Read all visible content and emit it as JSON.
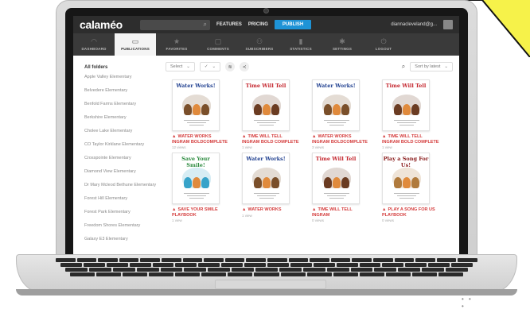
{
  "app": {
    "logo": "calaméo",
    "search_icon": "⌕"
  },
  "topnav": {
    "features": "FEATURES",
    "pricing": "PRICING",
    "publish": "PUBLISH",
    "user": "diannacleveland@g..."
  },
  "tabs": [
    {
      "label": "DASHBOARD",
      "icon": "dashboard-icon",
      "glyph": "◠"
    },
    {
      "label": "PUBLICATIONS",
      "icon": "document-icon",
      "glyph": "▭",
      "active": true
    },
    {
      "label": "FAVORITES",
      "icon": "star-icon",
      "glyph": "★"
    },
    {
      "label": "COMMENTS",
      "icon": "comment-icon",
      "glyph": "▢"
    },
    {
      "label": "SUBSCRIBERS",
      "icon": "users-icon",
      "glyph": "⚇"
    },
    {
      "label": "STATISTICS",
      "icon": "chart-icon",
      "glyph": "▮"
    },
    {
      "label": "SETTINGS",
      "icon": "gear-icon",
      "glyph": "✱"
    },
    {
      "label": "LOGOUT",
      "icon": "power-icon",
      "glyph": "⏻"
    }
  ],
  "sidebar": {
    "heading": "All folders",
    "folders": [
      "Apple Valley Elementary",
      "Belvedere Elementary",
      "Benfold Farms Elementary",
      "Berkshire Elementary",
      "Cholee Lake Elementary",
      "CO Taylor Kirklane Elementary",
      "Crosspointe Elementary",
      "Diamond View Elementary",
      "Dr Mary Mcleod Bethune Elementary",
      "Forest Hill Elementary",
      "Forest Park Elementary",
      "Freedom Shores Elementary",
      "Galaxy E3 Elementary"
    ]
  },
  "toolbar": {
    "select_label": "Select",
    "sort_label": "Sort by latest",
    "caret": "⌄",
    "layers_icon": "≋",
    "share_icon": "≺",
    "search_icon": "⌕"
  },
  "publications": [
    {
      "cover_title": "Water Works!",
      "title": "WATER WORKS INGRAM BOLDCOMPLETE",
      "views": "12 views",
      "title_color": "#1f3f8f",
      "art_color": "#7a4f2a"
    },
    {
      "cover_title": "Time Will Tell",
      "title": "TIME WILL TELL INGRAM BOLD COMPLETE",
      "views": "1 view",
      "title_color": "#c4252d",
      "art_color": "#6b3c22"
    },
    {
      "cover_title": "Water Works!",
      "title": "WATER WORKS INGRAM BOLDCOMPLETE",
      "views": "3 views",
      "title_color": "#1f3f8f",
      "art_color": "#7a4f2a"
    },
    {
      "cover_title": "Time Will Tell",
      "title": "TIME WILL TELL INGRAM BOLD COMPLETE",
      "views": "1 view",
      "title_color": "#c4252d",
      "art_color": "#6b3c22"
    },
    {
      "cover_title": "Save Your Smile!",
      "title": "SAVE YOUR SMILE PLAYBOOK",
      "views": "1 view",
      "title_color": "#2b8a3e",
      "art_color": "#37a3c9"
    },
    {
      "cover_title": "Water Works!",
      "title": "WATER WORKS",
      "views": "1 view",
      "title_color": "#1f3f8f",
      "art_color": "#7a4f2a"
    },
    {
      "cover_title": "Time Will Tell",
      "title": "TIME WILL TELL INGRAM",
      "views": "0 views",
      "title_color": "#c4252d",
      "art_color": "#6b3c22"
    },
    {
      "cover_title": "Play a Song For Us!",
      "title": "PLAY A SONG FOR US PLAYBOOK",
      "views": "0 views",
      "title_color": "#8a1c1c",
      "art_color": "#b07a3c"
    }
  ],
  "colors": {
    "accent": "#1e93d6",
    "title_red": "#d43c3c",
    "topbar": "#2d2d2d",
    "subnav": "#3a3a3a",
    "highlight": "#f6f24a"
  }
}
